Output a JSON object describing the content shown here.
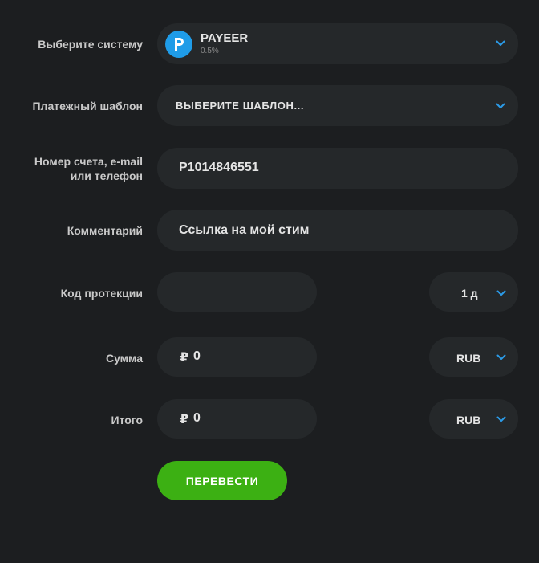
{
  "system": {
    "label": "Выберите систему",
    "name": "PAYEER",
    "fee": "0.5%",
    "logo_icon": "payeer-logo-icon"
  },
  "template": {
    "label": "Платежный шаблон",
    "value": "ВЫБЕРИТЕ ШАБЛОН..."
  },
  "account": {
    "label_line1": "Номер счета, e-mail",
    "label_line2": "или телефон",
    "value": "P1014846551"
  },
  "comment": {
    "label": "Комментарий",
    "value": "Ссылка на мой стим"
  },
  "protection": {
    "label": "Код протекции",
    "value": "",
    "period": "1 д"
  },
  "amount": {
    "label": "Сумма",
    "currency_symbol": "₽",
    "value": "0",
    "currency": "RUB"
  },
  "total": {
    "label": "Итого",
    "currency_symbol": "₽",
    "value": "0",
    "currency": "RUB"
  },
  "submit_label": "ПЕРЕВЕСТИ",
  "colors": {
    "background": "#1c1e20",
    "field": "#25282a",
    "accent_chevron": "#2b9be8",
    "button": "#3cb013"
  }
}
